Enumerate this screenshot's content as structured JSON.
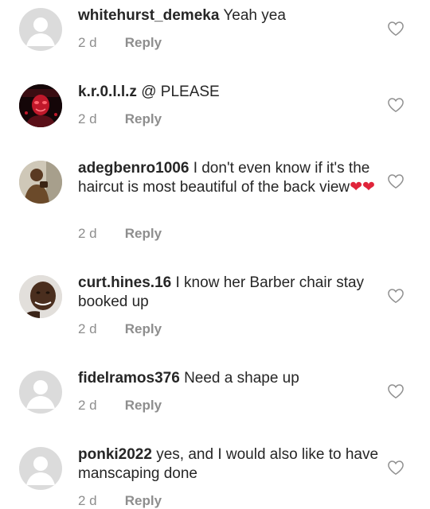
{
  "comments": [
    {
      "username": "whitehurst_demeka",
      "text": "Yeah yea",
      "time": "2 d",
      "reply_label": "Reply",
      "avatar": "default-avatar-icon"
    },
    {
      "username": "k.r.0.l.l.z",
      "text": "@ PLEASE",
      "time": "2 d",
      "reply_label": "Reply",
      "avatar": "user-photo-avatar"
    },
    {
      "username": "adegbenro1006",
      "text": "I don't even know if it's the haircut is most beautiful of the back view",
      "emoji": "❤❤",
      "time": "2 d",
      "reply_label": "Reply",
      "avatar": "user-photo-avatar"
    },
    {
      "username": "curt.hines.16",
      "text": "I know her Barber chair stay booked up",
      "time": "2 d",
      "reply_label": "Reply",
      "avatar": "user-photo-avatar"
    },
    {
      "username": "fidelramos376",
      "text": "Need a shape up",
      "time": "2 d",
      "reply_label": "Reply",
      "avatar": "default-avatar-icon"
    },
    {
      "username": "ponki2022",
      "text": "yes, and I would also like to have manscaping done",
      "time": "2 d",
      "reply_label": "Reply",
      "avatar": "default-avatar-icon"
    }
  ],
  "colors": {
    "text": "#262626",
    "muted": "#8e8e8e",
    "avatar_bg": "#dbdbdb",
    "heart": "#e0243a"
  }
}
